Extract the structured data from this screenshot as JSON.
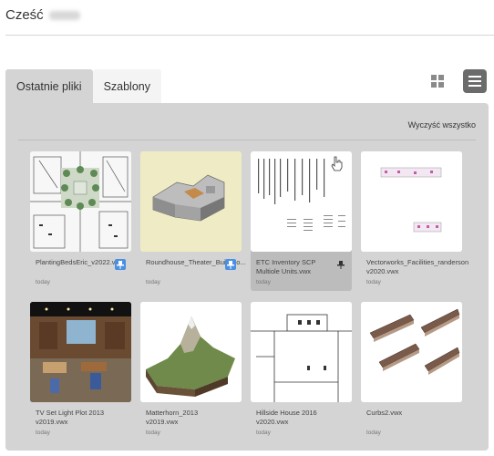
{
  "greeting": "Cześć",
  "tabs": {
    "recent": "Ostatnie pliki",
    "templates": "Szablony"
  },
  "clear_all": "Wyczyść wszystko",
  "colors": {
    "panel": "#d4d4d4",
    "pin_active": "#4a90e2",
    "list_button": "#6b6b6b"
  },
  "files": [
    {
      "name": "PlantingBedsEric_v2022.vwx",
      "date": "today",
      "pinned": true,
      "thumb": "site-plan-icon"
    },
    {
      "name": "Roundhouse_Theater_Buildino...",
      "date": "today",
      "pinned": true,
      "thumb": "building-model-icon"
    },
    {
      "name": "ETC Inventory SCP Multiole Units.vwx",
      "date": "today",
      "pinned": false,
      "thumb": "inventory-sheet-icon"
    },
    {
      "name": "Vectorworks_Facilities_randerson v2020.vwx",
      "date": "today",
      "pinned": false,
      "thumb": "facilities-plan-icon"
    },
    {
      "name": "TV Set Light Plot 2013 v2019.vwx",
      "date": "today",
      "pinned": false,
      "thumb": "tv-set-render-icon"
    },
    {
      "name": "Matterhorn_2013 v2019.vwx",
      "date": "today",
      "pinned": false,
      "thumb": "mountain-terrain-icon"
    },
    {
      "name": "Hillside House 2016 v2020.vwx",
      "date": "today",
      "pinned": false,
      "thumb": "elevation-drawing-icon"
    },
    {
      "name": "Curbs2.vwx",
      "date": "today",
      "pinned": false,
      "thumb": "curbs-model-icon"
    }
  ]
}
